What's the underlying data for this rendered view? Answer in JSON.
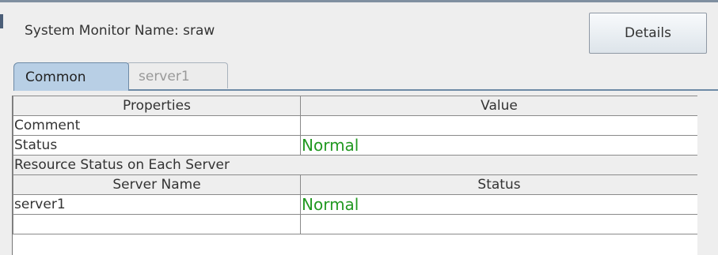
{
  "header": {
    "title": "System Monitor Name: sraw",
    "details_label": "Details"
  },
  "tabs": [
    {
      "label": "Common",
      "active": true
    },
    {
      "label": "server1",
      "active": false
    }
  ],
  "table": {
    "columns": [
      "Properties",
      "Value"
    ],
    "rows": [
      {
        "property": "Comment",
        "value": ""
      },
      {
        "property": "Status",
        "value": "Normal"
      }
    ],
    "section_title": "Resource Status on Each Server",
    "server_columns": [
      "Server Name",
      "Status"
    ],
    "server_rows": [
      {
        "name": "server1",
        "status": "Normal"
      }
    ]
  },
  "colors": {
    "status_normal": "#229922",
    "active_tab": "#b8cfe5"
  }
}
